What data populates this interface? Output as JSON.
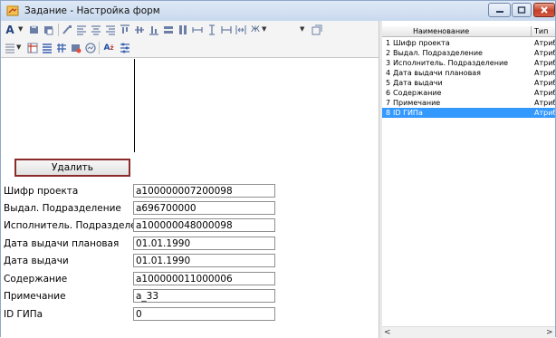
{
  "window": {
    "title": "Задание - Настройка форм",
    "min_glyph": "—",
    "max_glyph": "□",
    "close_glyph": "×"
  },
  "toolbar": {
    "font_glyph": "A",
    "sort_glyph": "A",
    "sort_sub": "ž"
  },
  "form": {
    "delete_label": "Удалить",
    "fields": [
      {
        "label": "Шифр проекта",
        "value": "a100000007200098"
      },
      {
        "label": "Выдал. Подразделение",
        "value": "a696700000"
      },
      {
        "label": "Исполнитель. Подразделе",
        "value": "a100000048000098"
      },
      {
        "label": "Дата выдачи плановая",
        "value": "01.01.1990"
      },
      {
        "label": "Дата выдачи",
        "value": "01.01.1990"
      },
      {
        "label": "Содержание",
        "value": "a100000011000006"
      },
      {
        "label": "Примечание",
        "value": "a_33"
      },
      {
        "label": "ID ГИПа",
        "value": "0"
      }
    ]
  },
  "grid": {
    "columns": {
      "name": "Наименование",
      "type": "Тип"
    },
    "rows": [
      {
        "num": "1",
        "name": "Шифр проекта",
        "type": "Атрибут"
      },
      {
        "num": "2",
        "name": "Выдал. Подразделение",
        "type": "Атрибут"
      },
      {
        "num": "3",
        "name": "Исполнитель. Подразделение",
        "type": "Атрибут"
      },
      {
        "num": "4",
        "name": "Дата выдачи плановая",
        "type": "Атрибут"
      },
      {
        "num": "5",
        "name": "Дата выдачи",
        "type": "Атрибут"
      },
      {
        "num": "6",
        "name": "Содержание",
        "type": "Атрибут"
      },
      {
        "num": "7",
        "name": "Примечание",
        "type": "Атрибут"
      },
      {
        "num": "8",
        "name": "ID ГИПа",
        "type": "Атрибут"
      }
    ],
    "selected_row": 8,
    "scroll_left": "<",
    "scroll_right": ">"
  },
  "colors": {
    "selection": "#3399ff",
    "delete_border": "#8c2a2a",
    "close": "#c4402a"
  }
}
